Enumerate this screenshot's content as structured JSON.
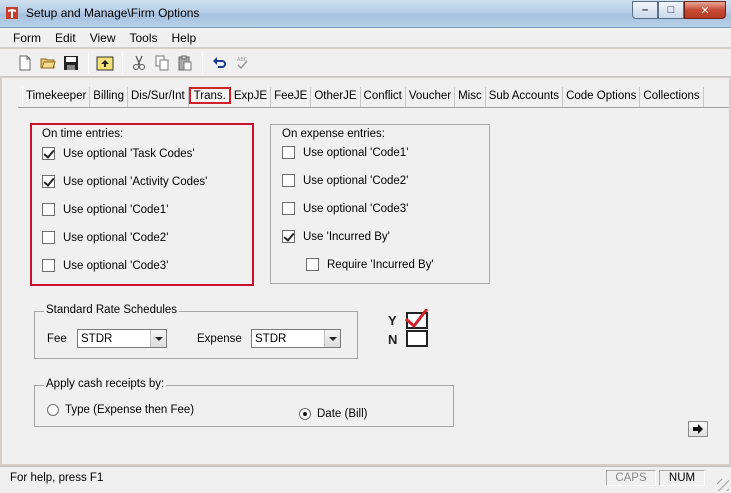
{
  "window": {
    "title": "Setup and Manage\\Firm Options",
    "minimize_glyph": "–",
    "maximize_glyph": "□",
    "close_glyph": "✕"
  },
  "menu": [
    "Form",
    "Edit",
    "View",
    "Tools",
    "Help"
  ],
  "toolbar_icons": [
    "new-document-icon",
    "open-folder-icon",
    "save-icon",
    "up-folder-icon",
    "cut-icon",
    "copy-icon",
    "paste-icon",
    "undo-icon",
    "spellcheck-icon"
  ],
  "tabs": [
    "Timekeeper",
    "Billing",
    "Dis/Sur/Int",
    "Trans.",
    "ExpJE",
    "FeeJE",
    "OtherJE",
    "Conflict",
    "Voucher",
    "Misc",
    "Sub Accounts",
    "Code Options",
    "Collections"
  ],
  "active_tab": "Trans.",
  "time_entries": {
    "title": "On time entries:",
    "items": [
      {
        "label": "Use optional 'Task Codes'",
        "checked": true
      },
      {
        "label": "Use optional 'Activity Codes'",
        "checked": true
      },
      {
        "label": "Use optional 'Code1'",
        "checked": false
      },
      {
        "label": "Use optional 'Code2'",
        "checked": false
      },
      {
        "label": "Use optional 'Code3'",
        "checked": false
      }
    ]
  },
  "expense_entries": {
    "title": "On expense entries:",
    "items": [
      {
        "label": "Use optional 'Code1'",
        "checked": false
      },
      {
        "label": "Use optional 'Code2'",
        "checked": false
      },
      {
        "label": "Use optional 'Code3'",
        "checked": false
      },
      {
        "label": "Use 'Incurred By'",
        "checked": true
      }
    ],
    "require_incurred": {
      "label": "Require 'Incurred By'",
      "checked": false
    }
  },
  "rate_schedules": {
    "title": "Standard Rate Schedules",
    "fee_label": "Fee",
    "fee_value": "STDR",
    "expense_label": "Expense",
    "expense_value": "STDR"
  },
  "cash_receipts": {
    "title": "Apply cash receipts by:",
    "option_type": "Type (Expense then Fee)",
    "option_date": "Date (Bill)",
    "selected": "date"
  },
  "yn_icon": {
    "y": "Y",
    "n": "N"
  },
  "status": {
    "help": "For help, press F1",
    "caps": "CAPS",
    "num": "NUM"
  },
  "colors": {
    "highlight_red": "#c8102e",
    "check_red": "#d2202a"
  }
}
